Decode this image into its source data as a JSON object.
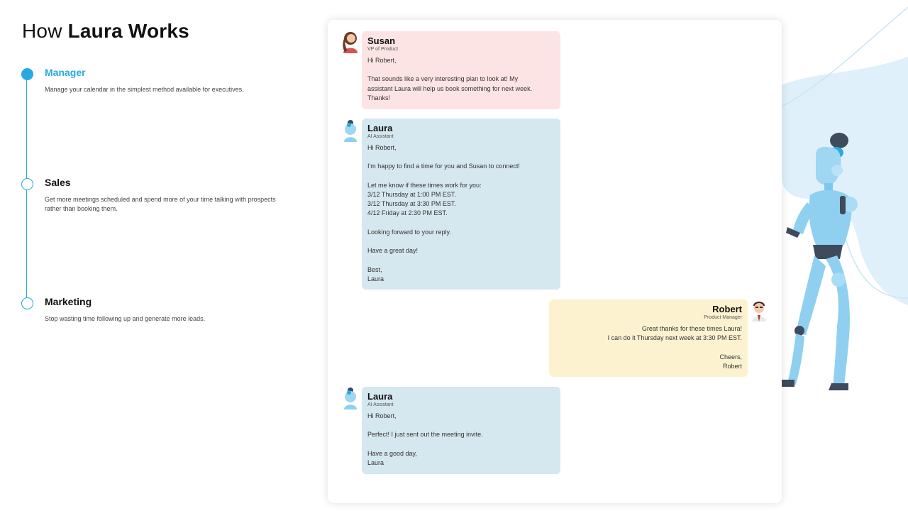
{
  "header": {
    "title_prefix": "How",
    "title_bold": "Laura Works"
  },
  "steps": [
    {
      "title": "Manager",
      "description": "Manage your calendar in the simplest method available for executives.",
      "active": true
    },
    {
      "title": "Sales",
      "description": "Get more meetings scheduled and spend more of your time talking with prospects rather than booking them.",
      "active": false
    },
    {
      "title": "Marketing",
      "description": "Stop wasting time following up and generate more leads.",
      "active": false
    }
  ],
  "messages": [
    {
      "name": "Susan",
      "role": "VP of Product",
      "lines": [
        "Hi Robert,",
        "",
        "That sounds like a very interesting plan to look at! My",
        "assistant Laura will help us book something for next week.",
        "Thanks!"
      ]
    },
    {
      "name": "Laura",
      "role": "AI Assistant",
      "lines": [
        "Hi Robert,",
        "",
        "I'm happy to find a time for you and Susan to connect!",
        "",
        "Let me know if these times work for you:",
        "3/12 Thursday at 1:00 PM EST.",
        "3/12 Thursday at 3:30 PM EST.",
        "4/12 Friday at 2:30 PM EST.",
        "",
        "Looking forward to your reply.",
        "",
        "Have a great day!",
        "",
        "Best,",
        "Laura"
      ]
    },
    {
      "name": "Robert",
      "role": "Product Manager",
      "lines": [
        "Great thanks for these times Laura!",
        "I can do it Thursday next week at 3:30 PM EST.",
        "",
        "Cheers,",
        "Robert"
      ]
    },
    {
      "name": "Laura",
      "role": "AI Assistant",
      "lines": [
        "Hi Robert,",
        "",
        "Perfect! I just sent out the meeting invite.",
        "",
        "Have a good day,",
        "Laura"
      ]
    }
  ],
  "colors": {
    "accent": "#29a9e0",
    "susan_bubble": "#fde4e4",
    "laura_bubble": "#d5e7ef",
    "robert_bubble": "#fdf2cf"
  }
}
